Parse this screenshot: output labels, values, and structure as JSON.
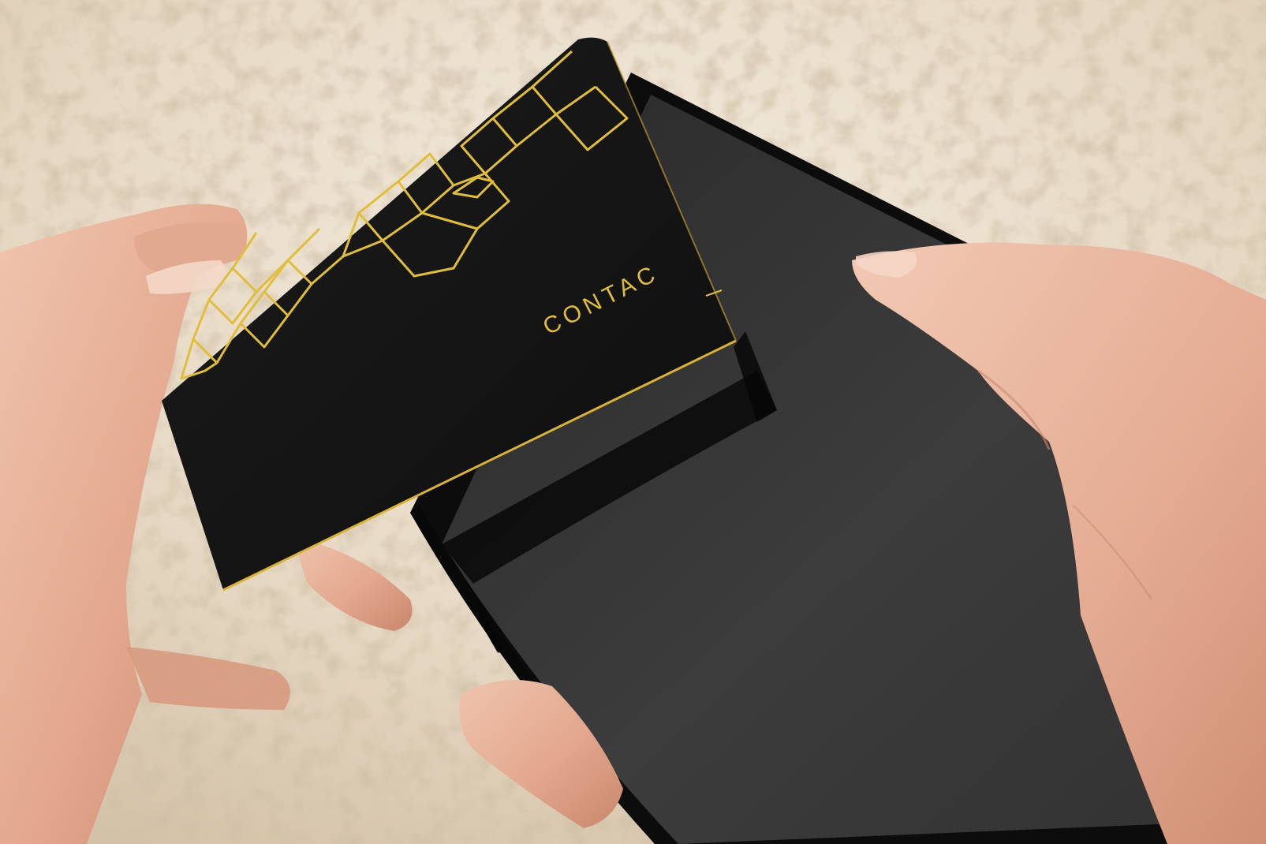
{
  "card": {
    "brand_text": "CONTAC"
  },
  "colors": {
    "background": "#e8dccb",
    "card_body": "#141414",
    "foil_gold": "#e0bd3a",
    "phone_body": "#0c0c0c",
    "phone_screen": "#3a3a3a",
    "skin": "#e8b69e"
  }
}
